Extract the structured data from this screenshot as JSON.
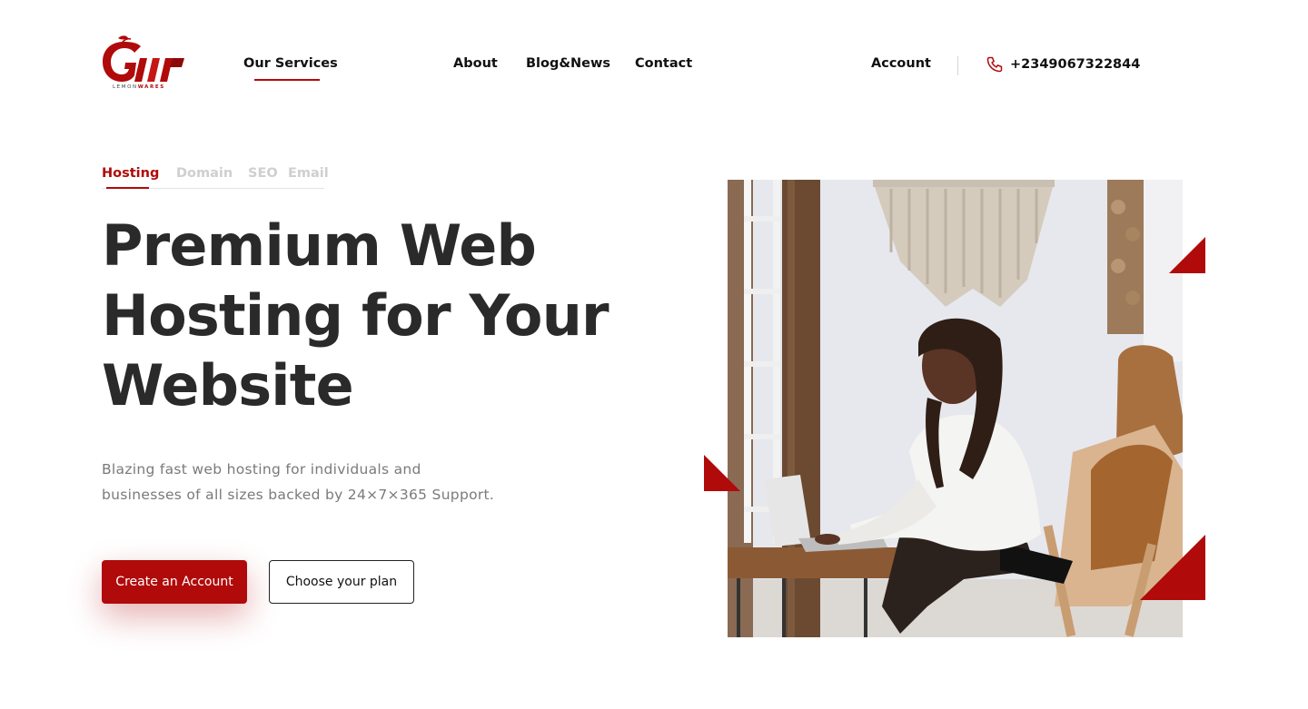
{
  "brand": {
    "logo_word_plain": "LEMON",
    "logo_word_accent": "WARES",
    "accent_color": "#b00a0a"
  },
  "nav": {
    "items": [
      {
        "label": "Our Services",
        "active": true
      },
      {
        "label": "About"
      },
      {
        "label": "Blog&News"
      },
      {
        "label": "Contact"
      }
    ],
    "account_label": "Account",
    "phone_number": "+2349067322844",
    "phone_icon": "phone-icon"
  },
  "hero": {
    "tabs": [
      {
        "label": "Hosting",
        "active": true
      },
      {
        "label": "Domain"
      },
      {
        "label": "SEO"
      },
      {
        "label": "Email"
      }
    ],
    "title_lines": [
      "Premium Web",
      "Hosting for Your",
      "Website"
    ],
    "subtitle_lines": [
      "Blazing fast web hosting for individuals and",
      "businesses of all sizes backed by 24×7×365 Support."
    ],
    "primary_button": "Create an Account",
    "secondary_button": "Choose your plan"
  }
}
